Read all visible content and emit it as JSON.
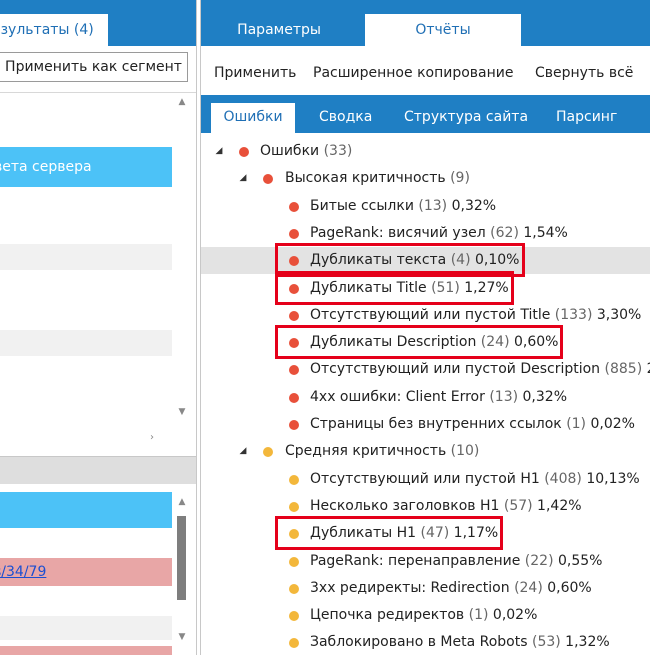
{
  "left_panel": {
    "tab_label": "езультаты (4)",
    "apply_segment_label": "Применить как сегмент",
    "highlighted_row_text": "вета сервера",
    "link_row_text": "s/34/79"
  },
  "right_panel": {
    "tabs": [
      {
        "label": "Параметры",
        "active": false
      },
      {
        "label": "Отчёты",
        "active": true
      }
    ],
    "toolbar": {
      "apply": "Применить",
      "copy": "Расширенное копирование",
      "collapse": "Свернуть всё"
    },
    "subtabs": [
      {
        "label": "Ошибки",
        "active": true
      },
      {
        "label": "Сводка",
        "active": false
      },
      {
        "label": "Структура сайта",
        "active": false
      },
      {
        "label": "Парсинг",
        "active": false
      }
    ],
    "tree": [
      {
        "label": "Ошибки",
        "count": "(33)",
        "pct": "",
        "level": 0,
        "color": "red",
        "expanded": true
      },
      {
        "label": "Высокая критичность",
        "count": "(9)",
        "pct": "",
        "level": 1,
        "color": "red",
        "expanded": true
      },
      {
        "label": "Битые ссылки",
        "count": "(13)",
        "pct": "0,32%",
        "level": 2,
        "color": "red"
      },
      {
        "label": "PageRank: висячий узел",
        "count": "(62)",
        "pct": "1,54%",
        "level": 2,
        "color": "red"
      },
      {
        "label": "Дубликаты текста",
        "count": "(4)",
        "pct": "0,10%",
        "level": 2,
        "color": "red",
        "selected": true,
        "boxed": true
      },
      {
        "label": "Дубликаты Title",
        "count": "(51)",
        "pct": "1,27%",
        "level": 2,
        "color": "red",
        "boxed": true
      },
      {
        "label": "Отсутствующий или пустой Title",
        "count": "(133)",
        "pct": "3,30%",
        "level": 2,
        "color": "red"
      },
      {
        "label": "Дубликаты Description",
        "count": "(24)",
        "pct": "0,60%",
        "level": 2,
        "color": "red",
        "boxed": true
      },
      {
        "label": "Отсутствующий или пустой Description",
        "count": "(885)",
        "pct": "2",
        "level": 2,
        "color": "red"
      },
      {
        "label": "4xx ошибки: Client Error",
        "count": "(13)",
        "pct": "0,32%",
        "level": 2,
        "color": "red"
      },
      {
        "label": "Страницы без внутренних ссылок",
        "count": "(1)",
        "pct": "0,02%",
        "level": 2,
        "color": "red"
      },
      {
        "label": "Средняя критичность",
        "count": "(10)",
        "pct": "",
        "level": 1,
        "color": "yellow",
        "expanded": true
      },
      {
        "label": "Отсутствующий или пустой H1",
        "count": "(408)",
        "pct": "10,13%",
        "level": 2,
        "color": "yellow"
      },
      {
        "label": "Несколько заголовков H1",
        "count": "(57)",
        "pct": "1,42%",
        "level": 2,
        "color": "yellow"
      },
      {
        "label": "Дубликаты H1",
        "count": "(47)",
        "pct": "1,17%",
        "level": 2,
        "color": "yellow",
        "boxed": true
      },
      {
        "label": "PageRank: перенаправление",
        "count": "(22)",
        "pct": "0,55%",
        "level": 2,
        "color": "yellow"
      },
      {
        "label": "3xx редиректы: Redirection",
        "count": "(24)",
        "pct": "0,60%",
        "level": 2,
        "color": "yellow"
      },
      {
        "label": "Цепочка редиректов",
        "count": "(1)",
        "pct": "0,02%",
        "level": 2,
        "color": "yellow"
      },
      {
        "label": "Заблокировано в Meta Robots",
        "count": "(53)",
        "pct": "1,32%",
        "level": 2,
        "color": "yellow"
      }
    ]
  },
  "colors": {
    "accent_blue": "#1f7fc4",
    "highlight_cyan": "#4cc2f7",
    "error_red": "#e8503a",
    "warning_yellow": "#f3b73b",
    "annotation_red": "#e5001a",
    "selected_row": "#e3e3e3"
  }
}
